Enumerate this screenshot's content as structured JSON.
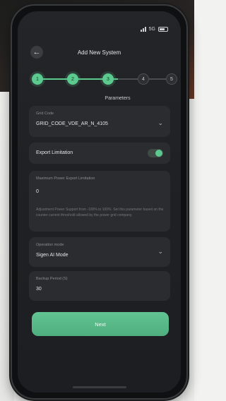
{
  "status_bar": {
    "signal_text": "5G"
  },
  "header": {
    "title": "Add New System"
  },
  "stepper": {
    "steps": [
      {
        "number": "1",
        "state": "done"
      },
      {
        "number": "2",
        "state": "done"
      },
      {
        "number": "3",
        "state": "done"
      },
      {
        "number": "4",
        "state": "todo"
      },
      {
        "number": "5",
        "state": "todo"
      }
    ],
    "active_label": "Parameters"
  },
  "fields": {
    "grid_code": {
      "label": "Grid Code",
      "value": "GRID_CODE_VDE_AR_N_4105"
    },
    "export_limitation": {
      "label": "Export Limitation",
      "enabled": true
    },
    "max_export": {
      "label": "Maximum Power Export Limitation",
      "value": "0",
      "help": "Adjustment Power Support from -100% to 100%. Set this parameter based on the counter current threshold allowed by the power grid company."
    },
    "operation_mode": {
      "label": "Operation mode",
      "value": "Sigen AI Mode"
    },
    "backup_period": {
      "label": "Backup Period (S)",
      "value": "30"
    }
  },
  "actions": {
    "next_label": "Next"
  },
  "colors": {
    "accent": "#5cc98f",
    "surface": "#2a2c2f",
    "background": "#1f2124"
  },
  "icons": [
    "back-arrow-icon",
    "signal-icon",
    "battery-icon",
    "chevron-down-icon"
  ]
}
